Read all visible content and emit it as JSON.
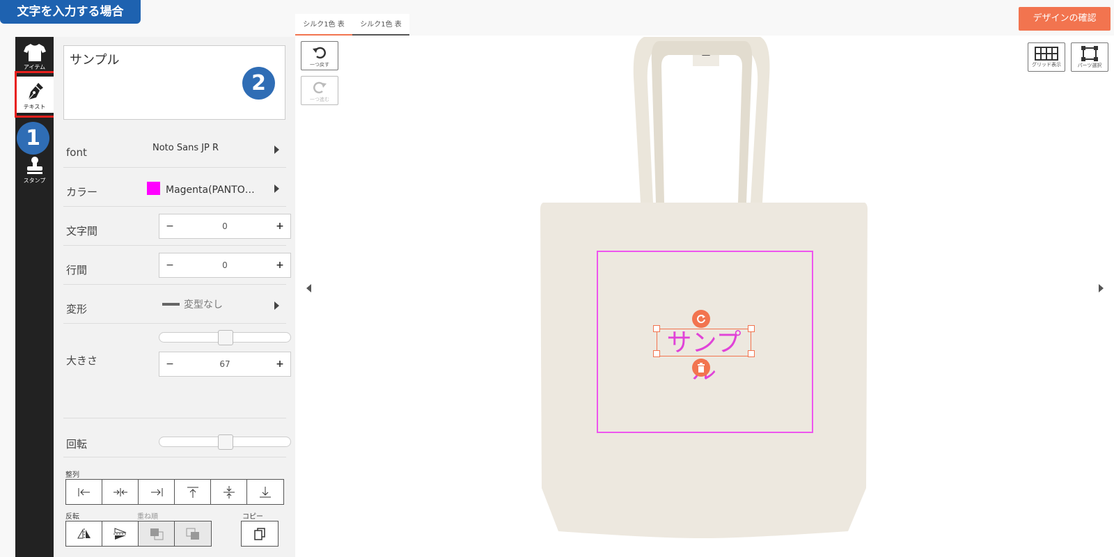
{
  "banner": {
    "title": "文字を入力する場合"
  },
  "header": {
    "confirm_label": "デザインの確認"
  },
  "tabs": [
    {
      "label": "シルク1色 表"
    },
    {
      "label": "シルク1色 表"
    }
  ],
  "toolbar": {
    "item_label": "アイテム",
    "text_label": "テキスト",
    "stamp_label": "スタンプ"
  },
  "badges": {
    "one": "1",
    "two": "2"
  },
  "panel": {
    "text_value": "サンプル",
    "font_label": "font",
    "font_value": "Noto Sans JP R",
    "color_label": "カラー",
    "color_value": "Magenta(PANTO…",
    "color_hex": "#ff00ff",
    "letter_spacing_label": "文字間",
    "letter_spacing_value": "0",
    "line_spacing_label": "行間",
    "line_spacing_value": "0",
    "transform_label": "変形",
    "transform_value": "変型なし",
    "size_label": "大きさ",
    "size_value": "67",
    "rotation_label": "回転",
    "align_label": "整列",
    "flip_label": "反転",
    "order_label": "重ね順",
    "copy_label": "コピー",
    "minus": "−",
    "plus": "+"
  },
  "canvas": {
    "undo_label": "一つ戻す",
    "redo_label": "一つ進む",
    "grid_label": "グリッド表示",
    "parts_label": "パーツ選択",
    "sample_text": "サンプル",
    "sample_color": "#e043d8",
    "accent_color": "#f2744f"
  }
}
